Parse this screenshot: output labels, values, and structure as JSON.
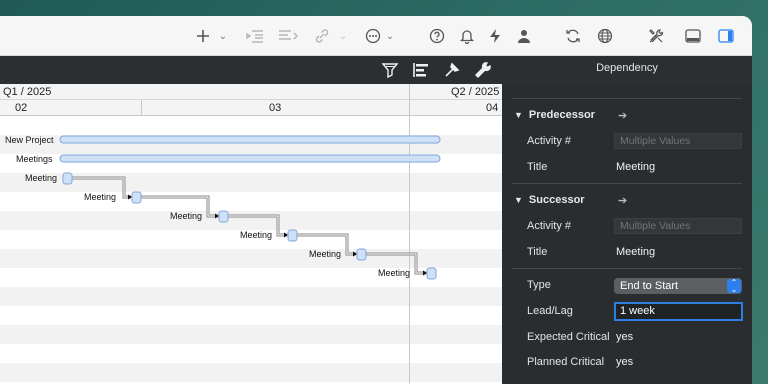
{
  "toolbar": {
    "icons": [
      "plus-icon",
      "indent-icon",
      "align-icon",
      "link-icon",
      "more-options-icon",
      "help-icon",
      "notification-bell-icon",
      "lightning-icon",
      "person-icon",
      "sync-icon",
      "globe-icon",
      "tools-icon",
      "bottom-panel-icon",
      "right-panel-icon"
    ]
  },
  "subbar": {
    "icons": [
      "filter-icon",
      "gantt-style-icon",
      "leveling-icon",
      "wrench-icon"
    ],
    "panel_title": "Dependency"
  },
  "gantt": {
    "quarter_left": "Q1 / 2025",
    "quarter_right": "Q2 / 2025",
    "months": [
      "02",
      "03",
      "04"
    ],
    "rows": [
      {
        "label": "New Project"
      },
      {
        "label": "Meetings"
      },
      {
        "label": "Meeting"
      },
      {
        "label": "Meeting"
      },
      {
        "label": "Meeting"
      },
      {
        "label": "Meeting"
      },
      {
        "label": "Meeting"
      },
      {
        "label": "Meeting"
      }
    ]
  },
  "inspector": {
    "predecessor": {
      "header": "Predecessor",
      "activity_label": "Activity #",
      "activity_placeholder": "Multiple Values",
      "title_label": "Title",
      "title_value": "Meeting"
    },
    "successor": {
      "header": "Successor",
      "activity_label": "Activity #",
      "activity_placeholder": "Multiple Values",
      "title_label": "Title",
      "title_value": "Meeting"
    },
    "type_label": "Type",
    "type_value": "End to Start",
    "leadlag_label": "Lead/Lag",
    "leadlag_value": "1 week",
    "expected_critical_label": "Expected Critical",
    "expected_critical_value": "yes",
    "planned_critical_label": "Planned Critical",
    "planned_critical_value": "yes"
  },
  "colors": {
    "bar_fill": "#cfe0f7",
    "bar_stroke": "#7ea6dc",
    "accent": "#2d7ff0"
  }
}
